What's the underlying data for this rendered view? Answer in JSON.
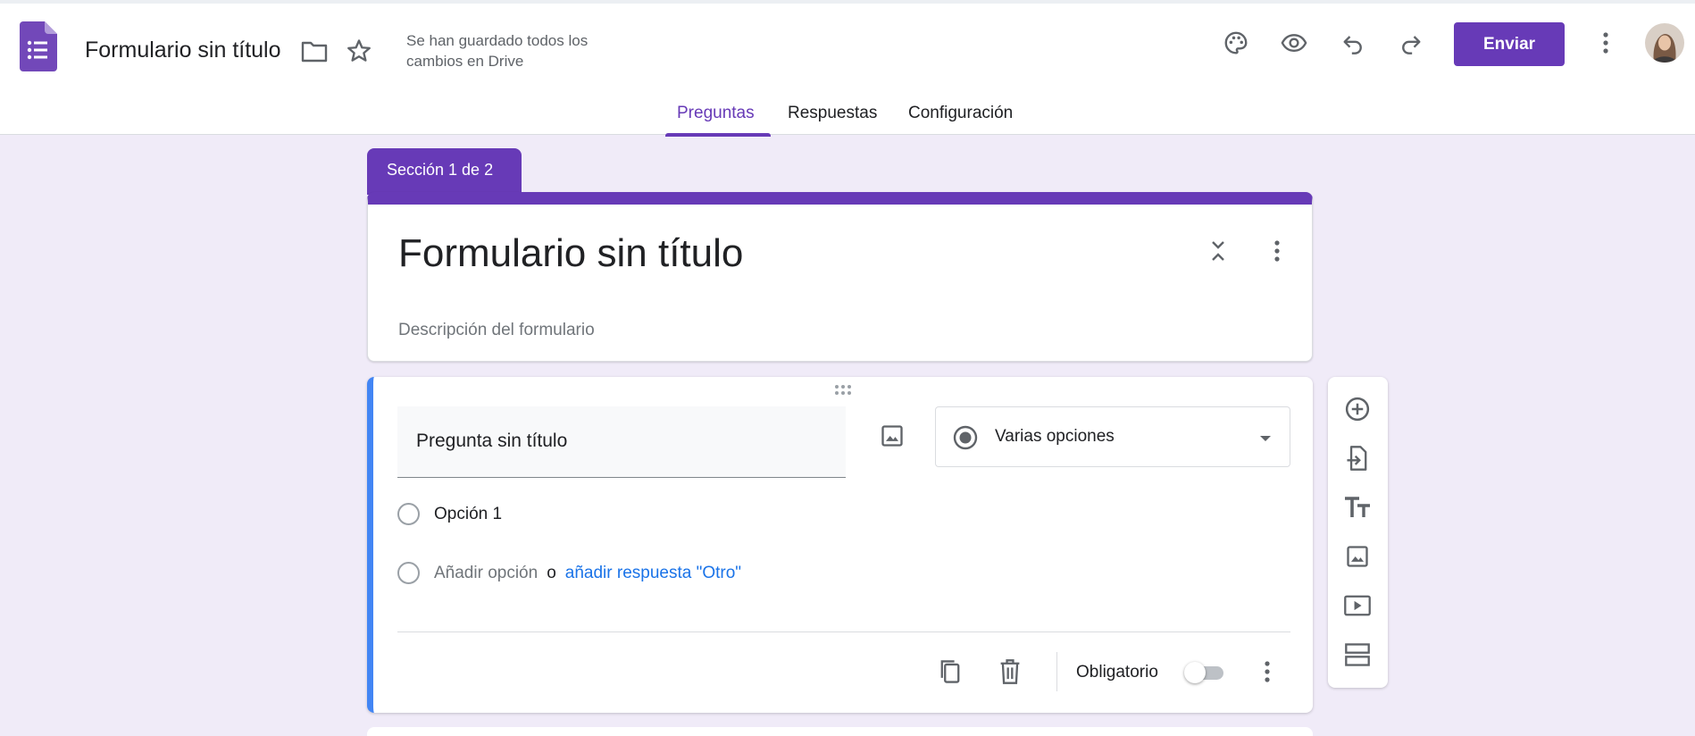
{
  "app": {
    "doc_title": "Formulario sin título",
    "save_status": "Se han guardado todos los cambios en Drive",
    "send_label": "Enviar"
  },
  "tabs": [
    {
      "label": "Preguntas",
      "active": true
    },
    {
      "label": "Respuestas",
      "active": false
    },
    {
      "label": "Configuración",
      "active": false
    }
  ],
  "section": {
    "label": "Sección 1 de 2"
  },
  "form": {
    "title": "Formulario sin título",
    "description": "Descripción del formulario"
  },
  "question": {
    "title": "Pregunta sin título",
    "type_label": "Varias opciones",
    "options": [
      "Opción 1"
    ],
    "add_option": "Añadir opción",
    "or_text": "o",
    "add_other": "añadir respuesta \"Otro\"",
    "required_label": "Obligatorio",
    "required": false
  },
  "icons": {
    "header": [
      "folder-icon",
      "star-icon",
      "palette-icon",
      "preview-icon",
      "undo-icon",
      "redo-icon",
      "more-vert-icon"
    ],
    "side_toolbar": [
      "add-question-icon",
      "import-questions-icon",
      "add-title-icon",
      "add-image-icon",
      "add-video-icon",
      "add-section-icon"
    ]
  },
  "colors": {
    "accent": "#673ab7",
    "background": "#f0ebf8",
    "question_active": "#4285f4",
    "link": "#1a73e8"
  }
}
